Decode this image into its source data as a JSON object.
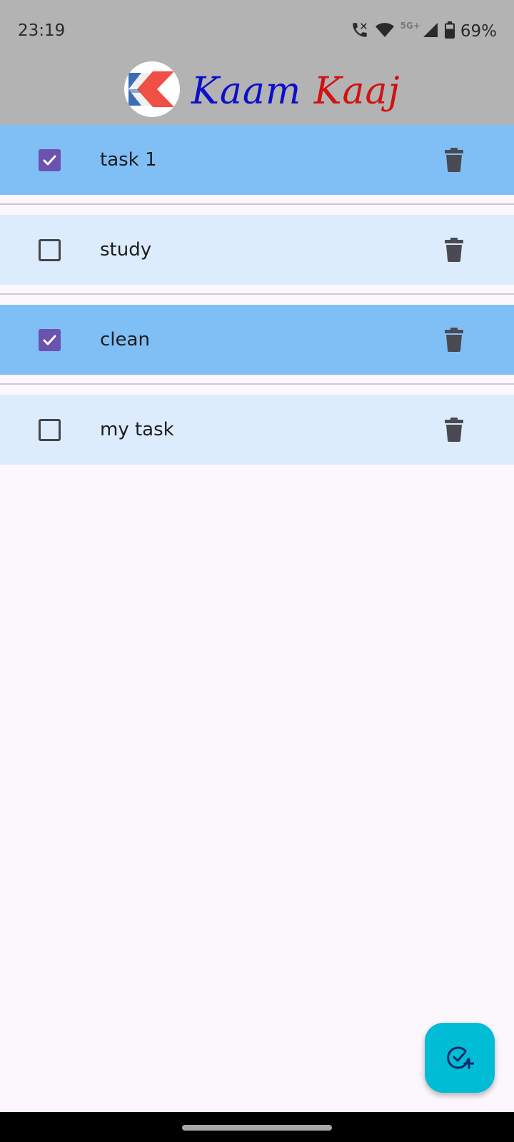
{
  "status_bar": {
    "time": "23:19",
    "network_label": "5G+",
    "battery": "69%",
    "icons": [
      "wifi-calling-icon",
      "wifi-icon",
      "cellular-signal-icon",
      "battery-icon"
    ]
  },
  "app": {
    "title_word1": "Kaam",
    "title_word2": "Kaaj",
    "colors": {
      "title_word1": "#0c10c8",
      "title_word2": "#d01212",
      "header_bg": "#b3b3b3",
      "done_row_bg": "#80bff6",
      "todo_row_bg": "#dcecfd",
      "checkbox_checked": "#6b52ae",
      "fab_bg": "#00bcd4"
    }
  },
  "tasks": [
    {
      "label": "task 1",
      "checked": true
    },
    {
      "label": "study",
      "checked": false
    },
    {
      "label": "clean",
      "checked": true
    },
    {
      "label": "my task",
      "checked": false
    }
  ],
  "fab": {
    "icon": "add-task-icon"
  }
}
